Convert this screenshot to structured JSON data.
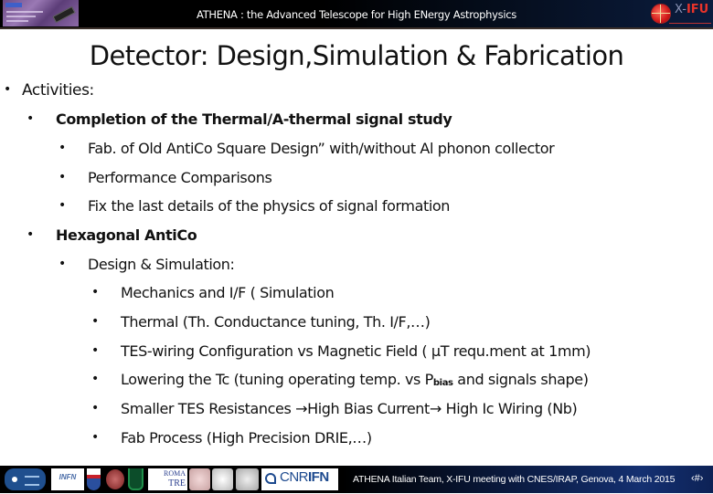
{
  "header": {
    "title": "ATHENA : the Advanced Telescope for High ENergy Astrophysics",
    "left_logo": "athena-banner-logo",
    "right_logo": {
      "x": "X",
      "dash": "-",
      "ifu": "IFU"
    }
  },
  "slide": {
    "title": "Detector: Design,Simulation & Fabrication",
    "bullet_char": "•",
    "items": {
      "activities": "Activities:",
      "completion": "Completion of the Thermal/A-thermal signal study",
      "fab_old": "Fab. of Old AntiCo Square Design” with/without Al phonon collector",
      "performance": "Performance Comparisons",
      "fix_details": "Fix the last details of the physics of signal formation",
      "hexagonal": "Hexagonal AntiCo",
      "design_sim": "Design & Simulation:",
      "mechanics": "Mechanics and I/F ( Simulation",
      "thermal": "Thermal (Th. Conductance tuning, Th. I/F,…)",
      "tes_wiring": "TES-wiring Configuration vs Magnetic Field ( µT requ.ment at 1mm)",
      "lowering_pre": "Lowering the Tc (tuning operating temp. vs P",
      "lowering_sub": "bias",
      "lowering_post": " and signals shape)",
      "smaller_tes": "Smaller TES Resistances →High Bias Current→ High Ic Wiring (Nb)",
      "fab_process": "Fab Process (High Precision DRIE,…)"
    }
  },
  "footer": {
    "text": "ATHENA Italian Team, X-IFU meeting with CNES/IRAP, Genova, 4 March 2015",
    "page_number": "‹#›",
    "logos": {
      "infn": "INFN",
      "roma_top": "ROMA",
      "roma_bottom": "TRE",
      "cnr": "CNR",
      "ifn": "IFN"
    }
  },
  "colors": {
    "header_bg": "#000000",
    "footer_accent": "#143071",
    "xifu_red": "#e8332a",
    "text": "#111111"
  }
}
